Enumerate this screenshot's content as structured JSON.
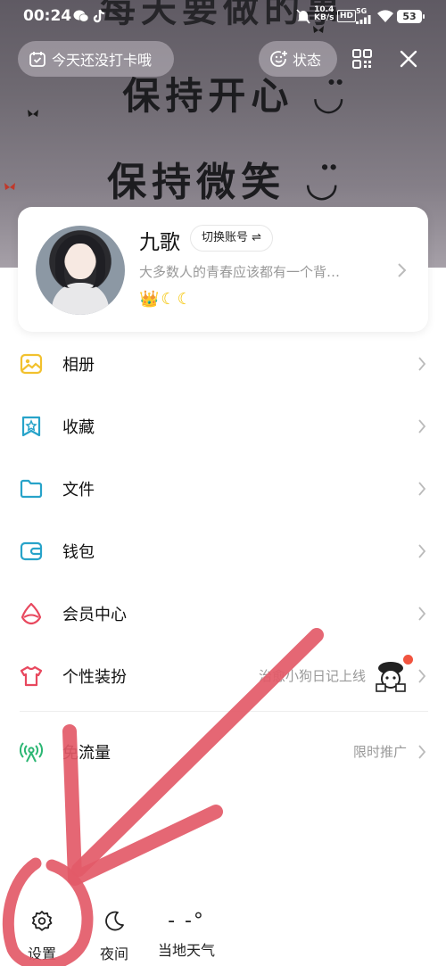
{
  "status_bar": {
    "time": "00:24",
    "net_speed_value": "10.4",
    "net_speed_unit": "KB/s",
    "hd": "HD",
    "network": "5G",
    "battery": "53"
  },
  "header": {
    "checkin_label": "今天还没打卡哦",
    "status_label": "状态"
  },
  "wallpaper": {
    "line1": "每天要做的事",
    "line2": "保持开心 ◡̈",
    "line3": "保持微笑 ◡̈"
  },
  "profile": {
    "nickname": "九歌",
    "switch_account": "切换账号 ⇌",
    "signature": "大多数人的青春应该都有一个背…",
    "badges": [
      "👑",
      "☾",
      "☾"
    ]
  },
  "menu": [
    {
      "label": "相册",
      "icon": "album-icon",
      "color": "#f2c12e"
    },
    {
      "label": "收藏",
      "icon": "favorites-icon",
      "color": "#27a3c9"
    },
    {
      "label": "文件",
      "icon": "folder-icon",
      "color": "#27a3c9"
    },
    {
      "label": "钱包",
      "icon": "wallet-icon",
      "color": "#27a3c9"
    },
    {
      "label": "会员中心",
      "icon": "vip-icon",
      "color": "#e8485e"
    },
    {
      "label": "个性装扮",
      "icon": "outfit-icon",
      "color": "#e8485e",
      "hint": "治愈小狗日记上线"
    },
    {
      "label": "免流量",
      "icon": "free-data-icon",
      "color": "#2bb673",
      "hint": "限时推广"
    }
  ],
  "bottom": {
    "settings": "设置",
    "night": "夜间",
    "weather_temp": "- -°",
    "weather_label": "当地天气"
  },
  "colors": {
    "annotation": "#e35a68"
  }
}
